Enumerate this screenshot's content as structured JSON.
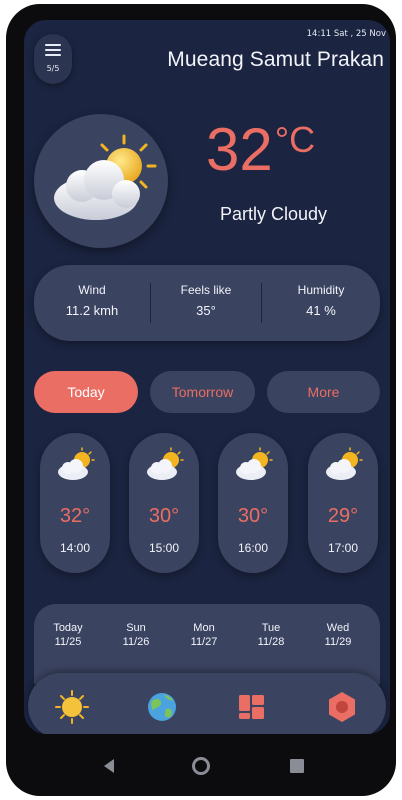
{
  "header": {
    "menu_count": "5/5",
    "datetime": "14:11 Sat , 25 Nov",
    "city": "Mueang Samut Prakan"
  },
  "current": {
    "temperature": "32",
    "unit": "°C",
    "condition": "Partly Cloudy",
    "icon": "partly-cloudy-icon"
  },
  "stats": [
    {
      "label": "Wind",
      "value": "11.2 kmh"
    },
    {
      "label": "Feels like",
      "value": "35°"
    },
    {
      "label": "Humidity",
      "value": "41 %"
    }
  ],
  "tabs": [
    {
      "label": "Today",
      "active": true
    },
    {
      "label": "Tomorrow",
      "active": false
    },
    {
      "label": "More",
      "active": false
    }
  ],
  "hourly": [
    {
      "temp": "32°",
      "time": "14:00",
      "icon": "partly-cloudy-icon"
    },
    {
      "temp": "30°",
      "time": "15:00",
      "icon": "partly-cloudy-icon"
    },
    {
      "temp": "30°",
      "time": "16:00",
      "icon": "partly-cloudy-icon"
    },
    {
      "temp": "29°",
      "time": "17:00",
      "icon": "partly-cloudy-icon"
    }
  ],
  "daily": [
    {
      "day": "Today",
      "date": "11/25"
    },
    {
      "day": "Sun",
      "date": "11/26"
    },
    {
      "day": "Mon",
      "date": "11/27"
    },
    {
      "day": "Tue",
      "date": "11/28"
    },
    {
      "day": "Wed",
      "date": "11/29"
    }
  ],
  "bottom_nav": [
    {
      "name": "sun-icon",
      "active": true
    },
    {
      "name": "globe-icon",
      "active": false
    },
    {
      "name": "dashboard-icon",
      "active": false
    },
    {
      "name": "settings-icon",
      "active": false
    }
  ],
  "system_nav": [
    "back-icon",
    "home-icon",
    "recents-icon"
  ],
  "colors": {
    "background": "#1b2440",
    "card": "#3a4360",
    "accent": "#ea6e64",
    "text": "#f2f4fa"
  }
}
